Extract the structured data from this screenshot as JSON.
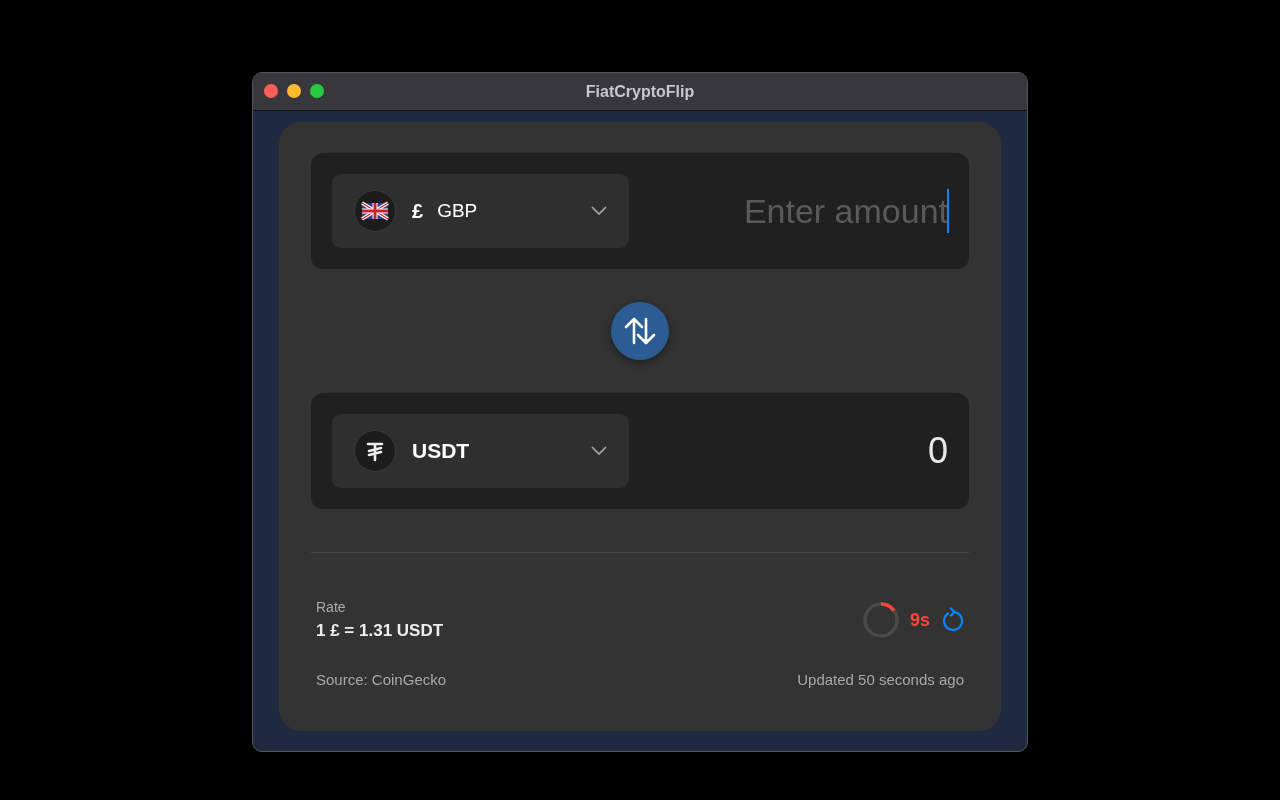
{
  "window": {
    "title": "FiatCryptoFlip"
  },
  "from": {
    "kind": "fiat",
    "symbol": "£",
    "code": "GBP",
    "amount": {
      "placeholder": "Enter amount",
      "focused": true
    }
  },
  "to": {
    "kind": "crypto",
    "code": "USDT",
    "amount": {
      "value": "0"
    }
  },
  "rate": {
    "label": "Rate",
    "value": "1 £ = 1.31 USDT"
  },
  "countdown": {
    "level": 0.15,
    "text": "9s"
  },
  "footer": {
    "source": "Source: CoinGecko",
    "updated": "Updated 50 seconds ago"
  }
}
